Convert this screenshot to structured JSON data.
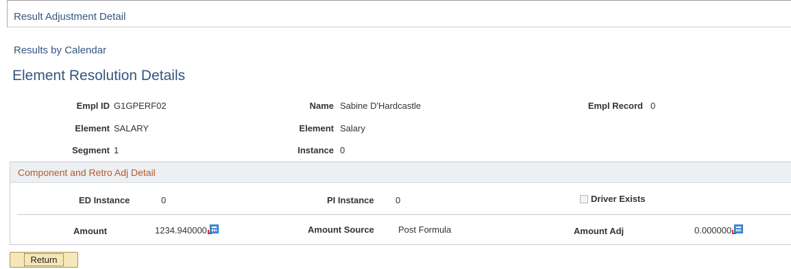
{
  "header": {
    "title": "Result Adjustment Detail"
  },
  "subheader": {
    "title": "Results by Calendar"
  },
  "page": {
    "title": "Element Resolution Details"
  },
  "fields": {
    "empl_id": {
      "label": "Empl ID",
      "value": "G1GPERF02"
    },
    "name": {
      "label": "Name",
      "value": "Sabine D'Hardcastle"
    },
    "empl_record": {
      "label": "Empl Record",
      "value": "0"
    },
    "element_code": {
      "label": "Element",
      "value": "SALARY"
    },
    "element_name": {
      "label": "Element",
      "value": "Salary"
    },
    "segment": {
      "label": "Segment",
      "value": "1"
    },
    "instance": {
      "label": "Instance",
      "value": "0"
    }
  },
  "detail": {
    "title": "Component and Retro Adj Detail",
    "ed_instance": {
      "label": "ED Instance",
      "value": "0"
    },
    "pi_instance": {
      "label": "PI Instance",
      "value": "0"
    },
    "driver_exists": {
      "label": "Driver Exists",
      "checked": false
    },
    "amount": {
      "label": "Amount",
      "value": "1234.940000",
      "icon": "calculator-icon"
    },
    "amount_source": {
      "label": "Amount Source",
      "value": "Post Formula"
    },
    "amount_adj": {
      "label": "Amount Adj",
      "value": "0.000000",
      "icon": "calculator-icon"
    }
  },
  "actions": {
    "return_label": "Return"
  }
}
